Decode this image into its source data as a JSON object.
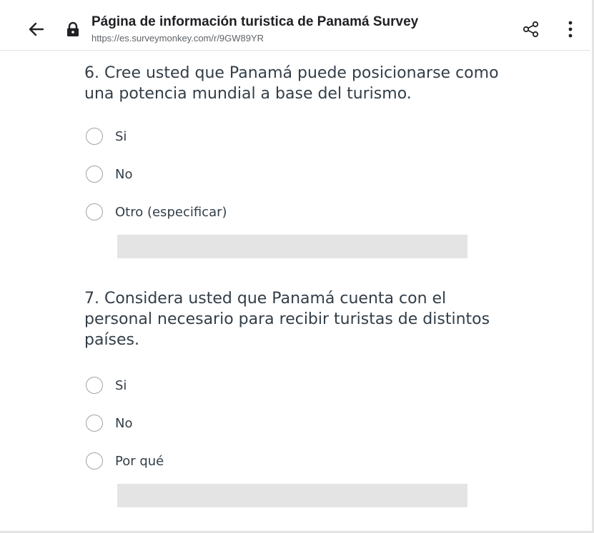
{
  "toolbar": {
    "page_title": "Página de información turistica de Panamá Survey",
    "url": "https://es.surveymonkey.com/r/9GW89YR",
    "icons": {
      "back": "arrow-left-icon",
      "secure": "lock-icon",
      "share": "share-icon",
      "menu": "more-vert-icon"
    }
  },
  "survey": {
    "questions": [
      {
        "text": "6. Cree usted que Panamá puede posicionarse como una potencia mundial a base del turismo.",
        "options": [
          {
            "label": "Si",
            "selected": false
          },
          {
            "label": "No",
            "selected": false
          },
          {
            "label": "Otro (especificar)",
            "selected": false
          }
        ],
        "other_input": {
          "value": "",
          "placeholder": ""
        }
      },
      {
        "text": "7. Considera usted que Panamá cuenta con el personal necesario para recibir turistas de distintos países.",
        "options": [
          {
            "label": "Si",
            "selected": false
          },
          {
            "label": "No",
            "selected": false
          },
          {
            "label": "Por qué",
            "selected": false
          }
        ],
        "other_input": {
          "value": "",
          "placeholder": ""
        }
      }
    ]
  },
  "colors": {
    "text": "#333e48",
    "radio_border": "#9da3a8",
    "input_background": "#e4e4e4",
    "toolbar_title": "#202124",
    "toolbar_url": "#5f6368"
  }
}
